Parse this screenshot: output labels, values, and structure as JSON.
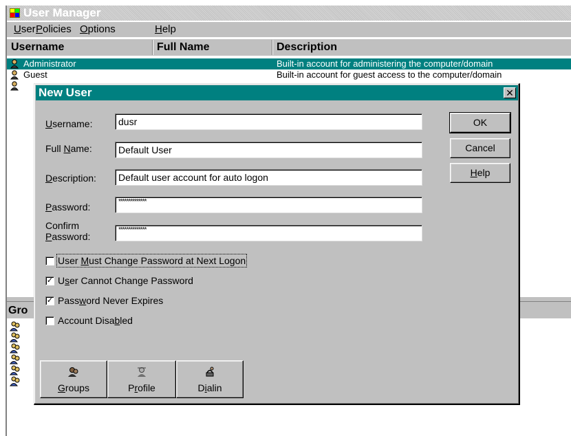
{
  "app": {
    "title": "User Manager"
  },
  "menubar": {
    "user": {
      "pre": "",
      "u": "U",
      "post": "ser"
    },
    "policies": {
      "pre": "",
      "u": "P",
      "post": "olicies"
    },
    "options": {
      "pre": "",
      "u": "O",
      "post": "ptions"
    },
    "help": {
      "pre": "",
      "u": "H",
      "post": "elp"
    }
  },
  "user_list": {
    "headers": {
      "username": "Username",
      "full_name": "Full Name",
      "description": "Description"
    },
    "rows": [
      {
        "username": "Administrator",
        "full_name": "",
        "description": "Built-in account for administering the computer/domain",
        "selected": true
      },
      {
        "username": "Guest",
        "full_name": "",
        "description": "Built-in account for guest access to the computer/domain",
        "selected": false
      }
    ]
  },
  "groups_panel": {
    "header_partial": "Gro"
  },
  "dialog": {
    "title": "New User",
    "close_glyph": "✕",
    "labels": {
      "username": {
        "u": "U",
        "post": "sername:"
      },
      "full_name": {
        "pre": "Full ",
        "u": "N",
        "post": "ame:"
      },
      "description": {
        "u": "D",
        "post": "escription:"
      },
      "password": {
        "u": "P",
        "post": "assword:"
      },
      "confirm_line1": "Confirm",
      "confirm": {
        "u": "P",
        "post": "assword:"
      }
    },
    "fields": {
      "username": "dusr",
      "full_name": "Default User",
      "description": "Default user account for auto logon",
      "password": "**************",
      "confirm_password": "**************"
    },
    "buttons": {
      "ok": "OK",
      "cancel": "Cancel",
      "help": {
        "u": "H",
        "post": "elp"
      }
    },
    "checkboxes": [
      {
        "pre": "User ",
        "u": "M",
        "post": "ust Change Password at Next Logon",
        "checked": false,
        "mark": ""
      },
      {
        "pre": "U",
        "u": "s",
        "post": "er Cannot Change Password",
        "checked": true,
        "mark": "✓"
      },
      {
        "pre": "Pass",
        "u": "w",
        "post": "ord Never Expires",
        "checked": true,
        "mark": "✓"
      },
      {
        "pre": "Account Disa",
        "u": "b",
        "post": "led",
        "checked": false,
        "mark": ""
      }
    ],
    "bottom_buttons": {
      "groups": {
        "u": "G",
        "post": "roups",
        "icon": "groups-icon"
      },
      "profile": {
        "pre": "P",
        "u": "r",
        "post": "ofile",
        "icon": "profile-icon"
      },
      "dialin": {
        "pre": "D",
        "u": "i",
        "post": "alin",
        "icon": "dialin-icon"
      }
    }
  },
  "colors": {
    "teal": "#008080",
    "face": "#c0c0c0"
  }
}
